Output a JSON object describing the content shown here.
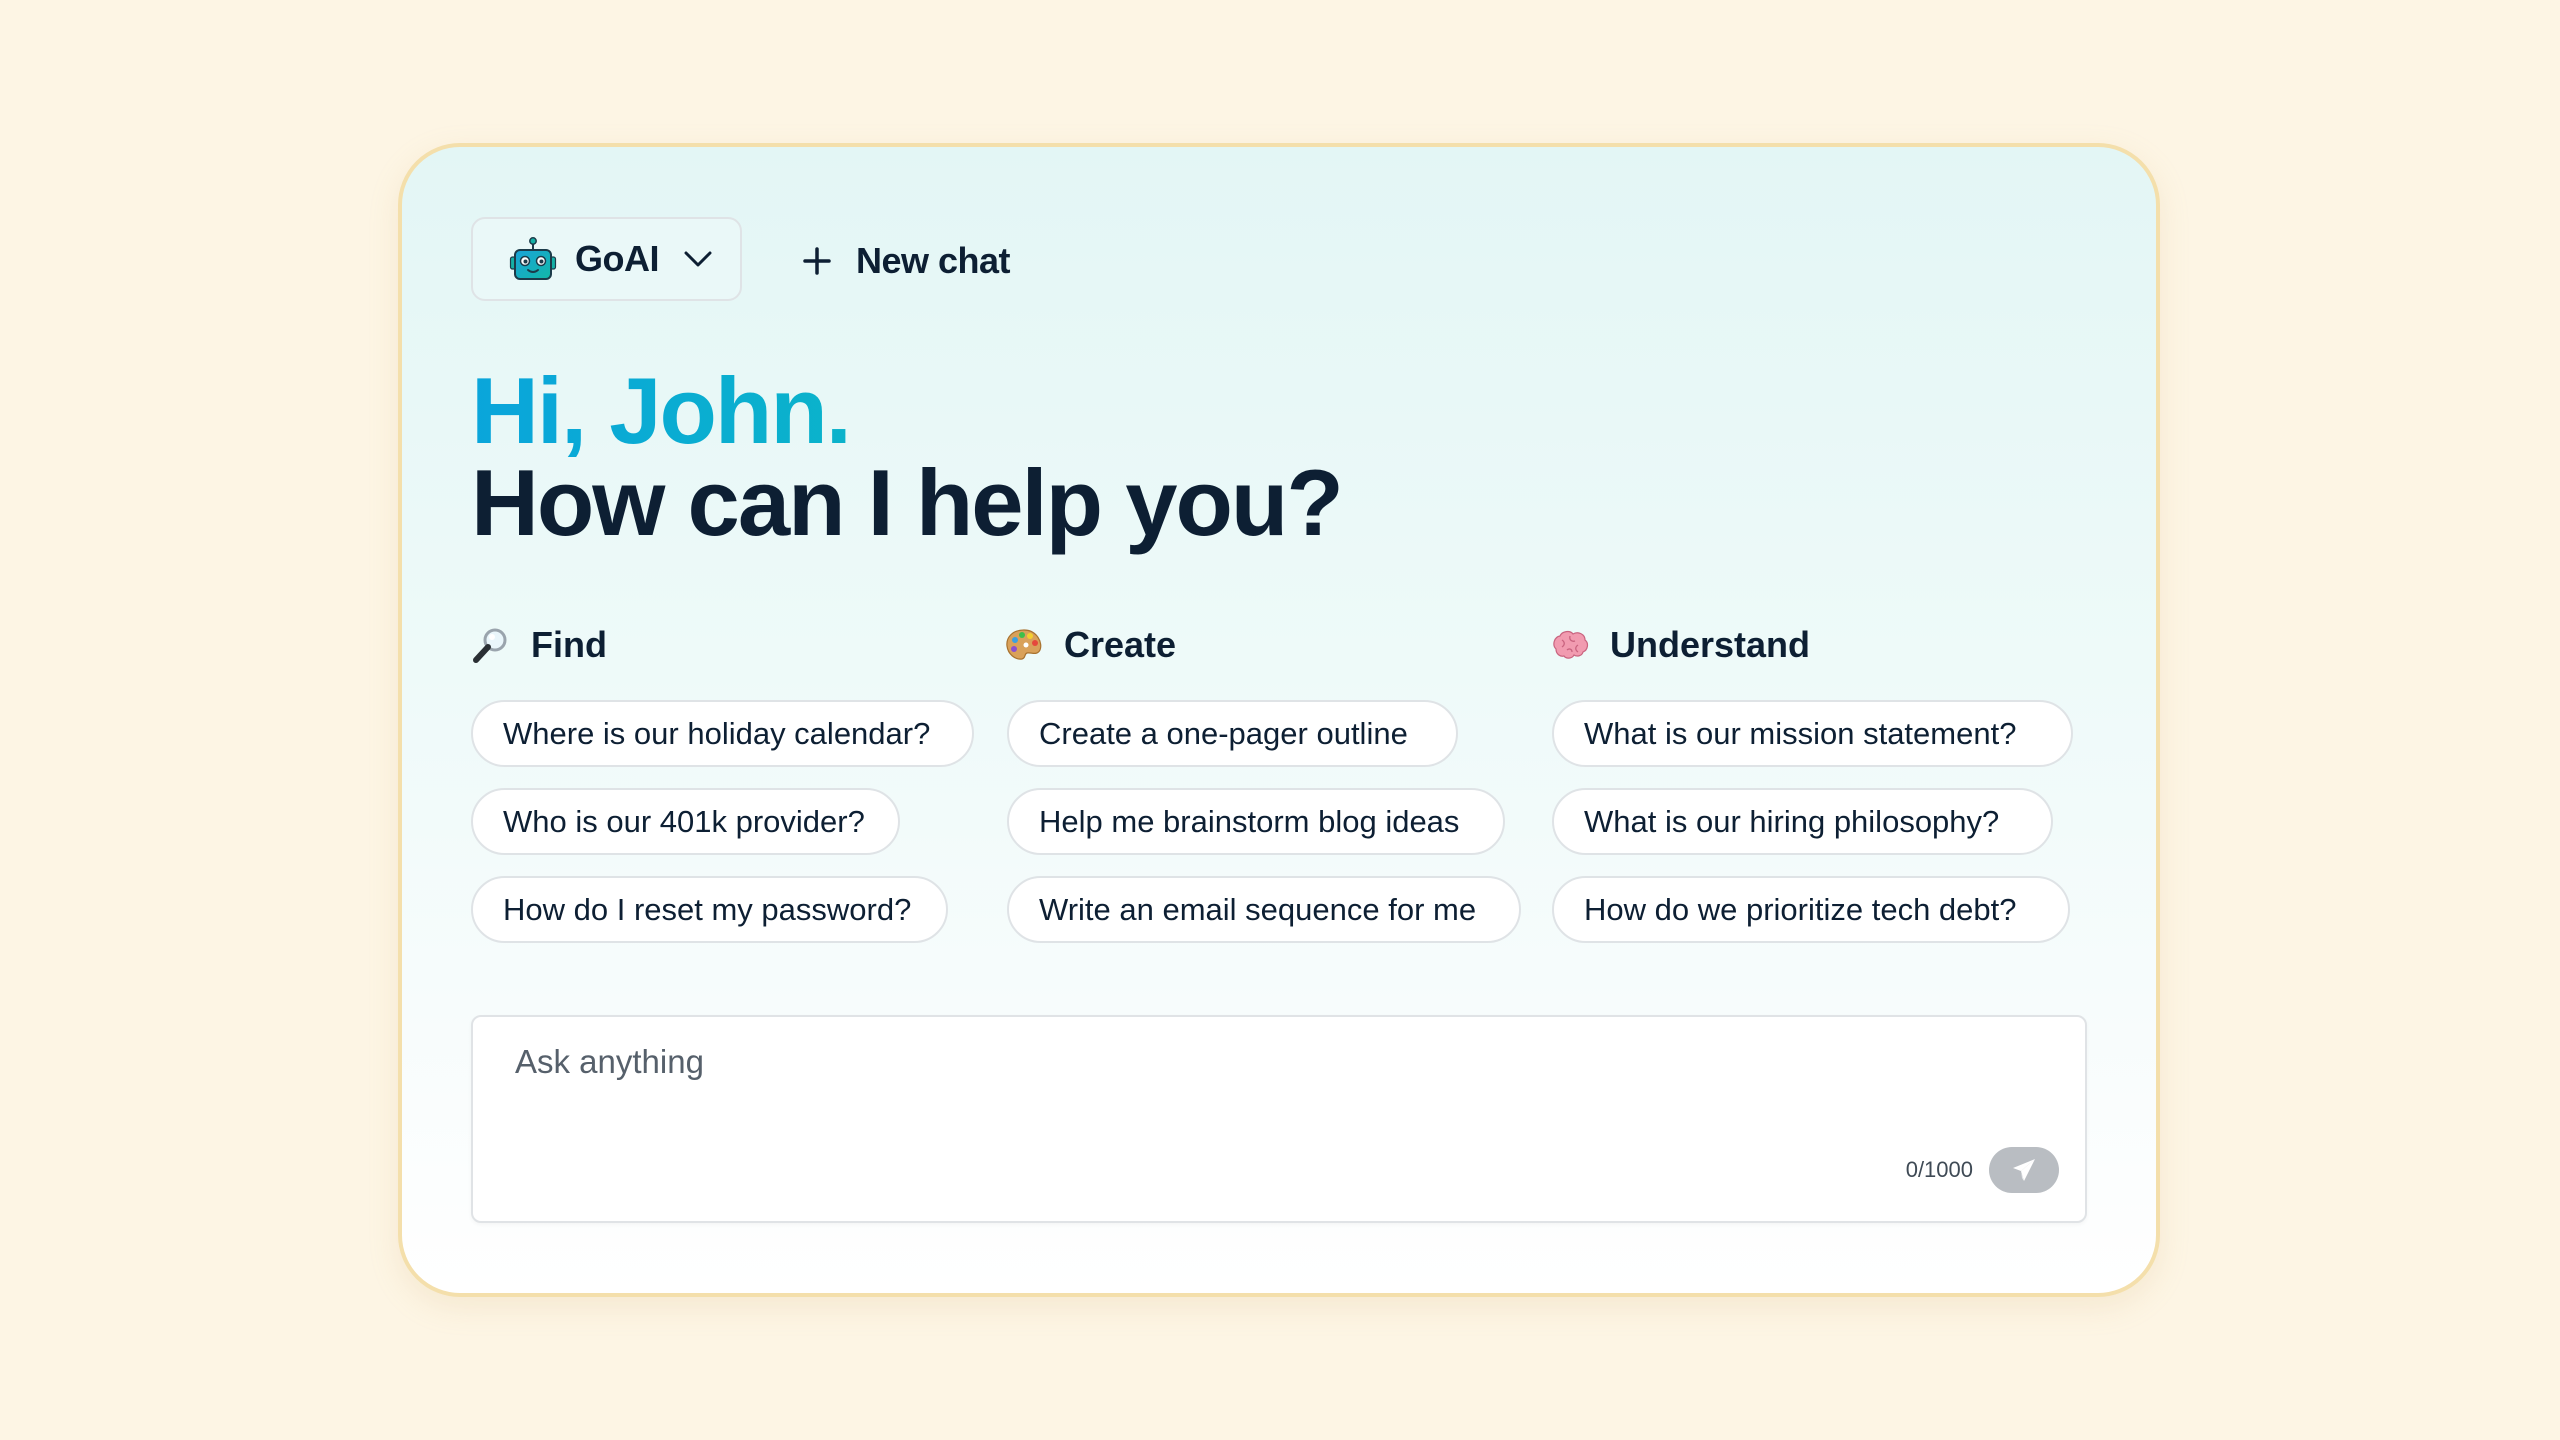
{
  "header": {
    "model_selector": {
      "label": "GoAI",
      "icon": "robot-icon",
      "chevron": "chevron-down-icon"
    },
    "new_chat": {
      "label": "New chat",
      "icon": "plus-icon"
    }
  },
  "greeting": {
    "hello": "Hi, John.",
    "question": "How can I help you?"
  },
  "sections": [
    {
      "title": "Find",
      "icon": "🔎",
      "chips": [
        "Where is our holiday calendar?",
        "Who is our 401k provider?",
        "How do I reset my password?"
      ]
    },
    {
      "title": "Create",
      "icon": "🎨",
      "chips": [
        "Create a one-pager outline",
        "Help me brainstorm blog ideas",
        "Write an email sequence for me"
      ]
    },
    {
      "title": "Understand",
      "icon": "🧠",
      "chips": [
        "What is our mission statement?",
        "What is our hiring philosophy?",
        "How do we prioritize tech debt?"
      ]
    }
  ],
  "composer": {
    "placeholder": "Ask anything",
    "value": "",
    "counter": "0/1000",
    "send_icon": "send-icon"
  },
  "colors": {
    "page_bg": "#fdf5e4",
    "card_border": "#f4dfab",
    "accent_start": "#0aa5db",
    "accent_end": "#11c0ad",
    "text": "#0d1f33",
    "send_disabled": "#b9bdc2"
  }
}
